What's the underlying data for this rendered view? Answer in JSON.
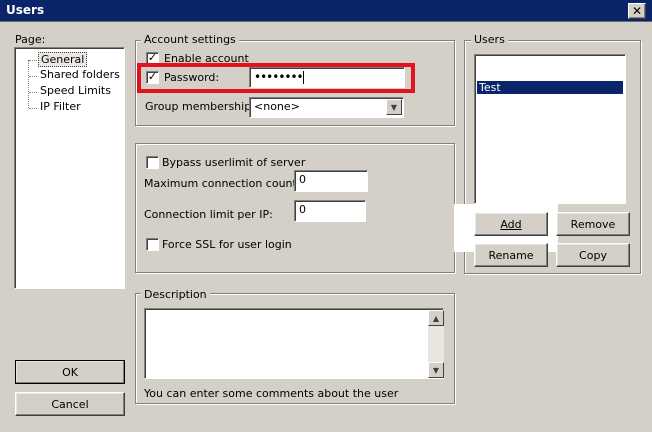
{
  "window": {
    "title": "Users",
    "close_label": "✕"
  },
  "page_panel": {
    "label": "Page:",
    "items": [
      {
        "label": "General",
        "selected": true
      },
      {
        "label": "Shared folders"
      },
      {
        "label": "Speed Limits"
      },
      {
        "label": "IP Filter"
      }
    ]
  },
  "account": {
    "legend": "Account settings",
    "enable_account_label": "Enable account",
    "enable_account_checked": true,
    "password_label": "Password:",
    "password_checked": true,
    "password_value": "••••••••",
    "group_label": "Group membership:",
    "group_value": "<none>"
  },
  "limits": {
    "bypass_label": "Bypass userlimit of server",
    "bypass_checked": false,
    "max_conn_label": "Maximum connection count:",
    "max_conn_value": "0",
    "conn_per_ip_label": "Connection limit per IP:",
    "conn_per_ip_value": "0",
    "force_ssl_label": "Force SSL for user login",
    "force_ssl_checked": false
  },
  "users": {
    "legend": "Users",
    "list": [
      {
        "label": "Test",
        "selected": true
      }
    ],
    "add_label": "Add",
    "remove_label": "Remove",
    "rename_label": "Rename",
    "copy_label": "Copy"
  },
  "description": {
    "legend": "Description",
    "value": "",
    "hint": "You can enter some comments about the user"
  },
  "ok_label": "OK",
  "cancel_label": "Cancel",
  "colors": {
    "titlebar": "#0a246a",
    "highlight": "#e0131f",
    "selection": "#0a246a"
  }
}
